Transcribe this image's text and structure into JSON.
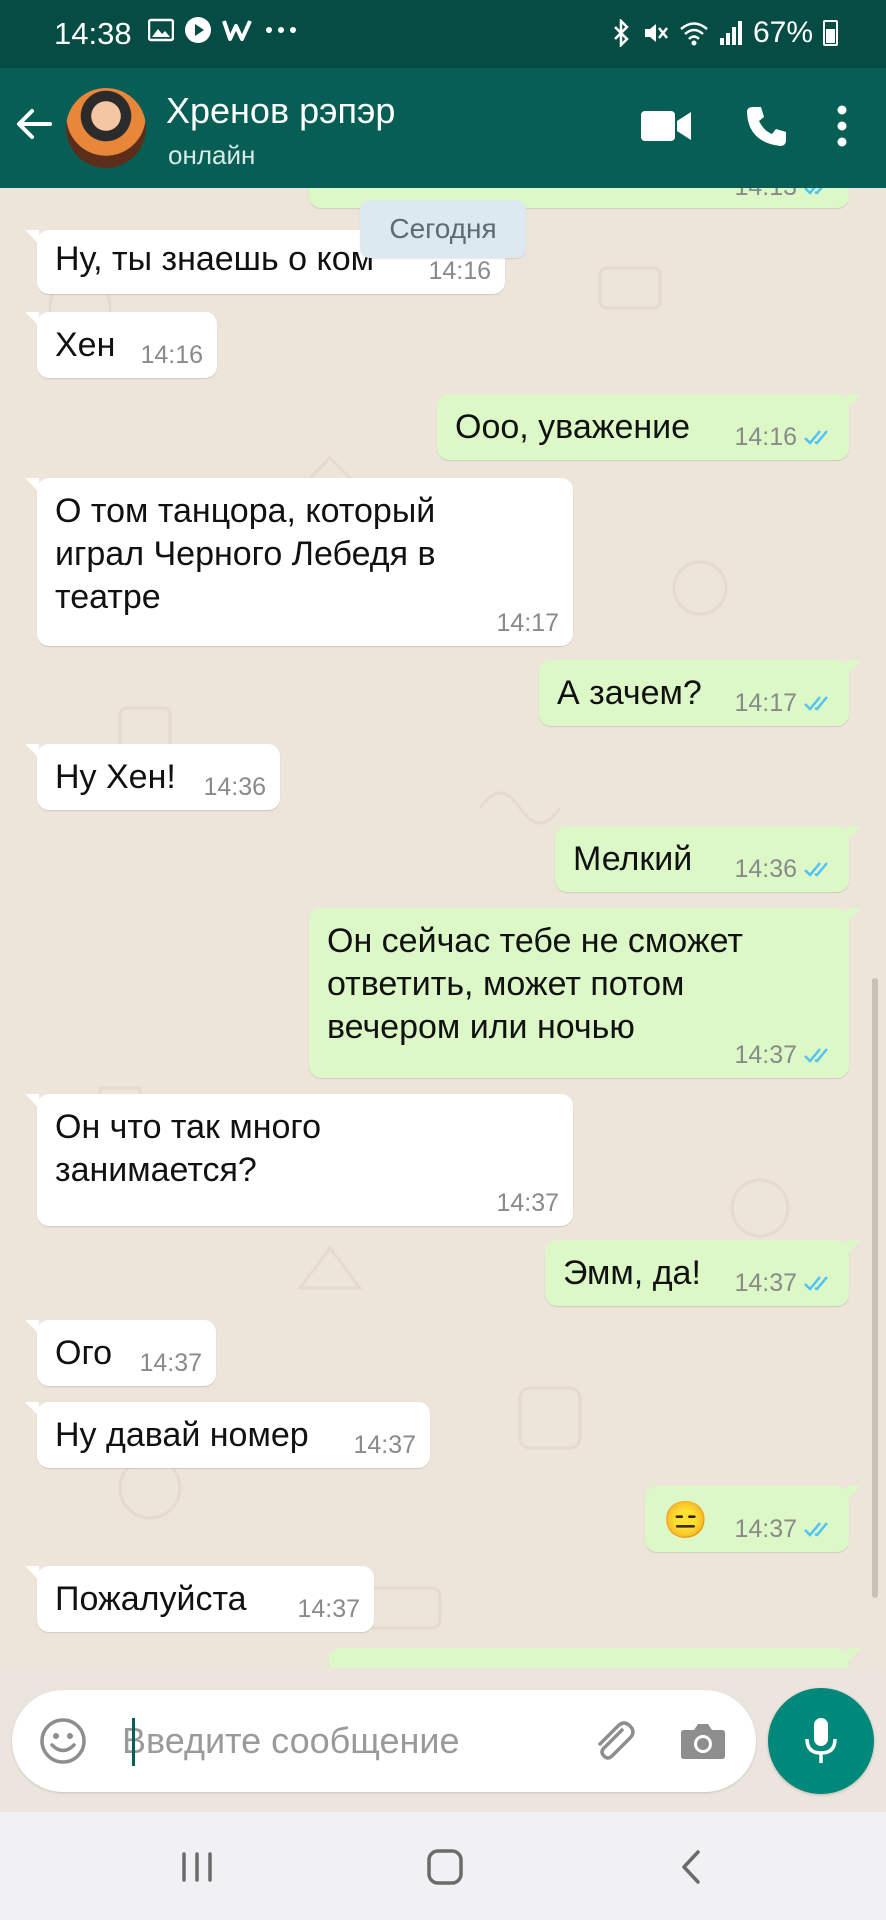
{
  "status_bar": {
    "time": "14:38",
    "battery": "67%",
    "icons": [
      "image-icon",
      "play-icon",
      "w-icon",
      "more-dots-icon",
      "bluetooth-icon",
      "mute-icon",
      "wifi-icon",
      "signal-icon",
      "battery-icon"
    ]
  },
  "header": {
    "contact_name": "Хренов рэпэр",
    "contact_status": "онлайн",
    "icons": [
      "back-arrow-icon",
      "video-call-icon",
      "phone-icon",
      "menu-dots-icon"
    ]
  },
  "chat": {
    "date_chip": "Сегодня",
    "partial_top_time": "14:13",
    "messages": [
      {
        "dir": "in",
        "text": "Ну, ты знаешь о ком",
        "time": "14:16"
      },
      {
        "dir": "in",
        "text": "Хен",
        "time": "14:16"
      },
      {
        "dir": "out",
        "text": "Ооо, уважение",
        "time": "14:16"
      },
      {
        "dir": "in",
        "text": "О том танцора, который играл Черного Лебедя в театре",
        "time": "14:17"
      },
      {
        "dir": "out",
        "text": "А зачем?",
        "time": "14:17"
      },
      {
        "dir": "in",
        "text": "Ну Хен!",
        "time": "14:36"
      },
      {
        "dir": "out",
        "text": "Мелкий",
        "time": "14:36"
      },
      {
        "dir": "out",
        "text": "Он сейчас тебе не сможет ответить, может потом вечером или ночью",
        "time": "14:37"
      },
      {
        "dir": "in",
        "text": "Он что так много занимается?",
        "time": "14:37"
      },
      {
        "dir": "out",
        "text": "Эмм, да!",
        "time": "14:37"
      },
      {
        "dir": "in",
        "text": "Ого",
        "time": "14:37"
      },
      {
        "dir": "in",
        "text": "Ну давай номер",
        "time": "14:37"
      },
      {
        "dir": "out",
        "text": "😑",
        "time": "14:37"
      },
      {
        "dir": "in",
        "text": "Пожалуйста",
        "time": "14:37"
      }
    ]
  },
  "input": {
    "placeholder": "Введите сообщение",
    "value": ""
  },
  "colors": {
    "header": "#075e54",
    "status_bar": "#054d44",
    "outgoing_bubble": "#dcf8c6",
    "incoming_bubble": "#ffffff",
    "read_ticks": "#4fc3f7",
    "mic_button": "#00897b"
  }
}
